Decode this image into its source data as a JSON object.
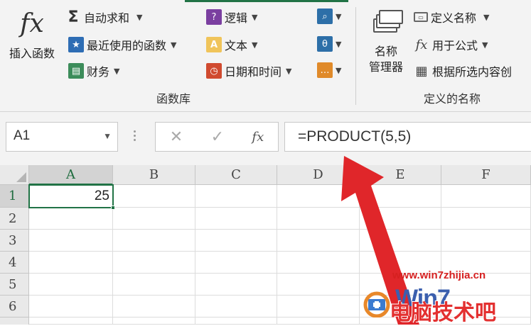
{
  "ribbon": {
    "insert_function": {
      "label": "插入函数",
      "icon": "fx-icon"
    },
    "functions": {
      "autosum": "自动求和",
      "recent": "最近使用的函数",
      "financial": "财务",
      "logical": "逻辑",
      "text": "文本",
      "datetime": "日期和时间",
      "text_icon_letter": "A"
    },
    "group_label_library": "函数库",
    "name_manager": {
      "line1": "名称",
      "line2": "管理器"
    },
    "define_name": "定义名称",
    "use_in_formula": "用于公式",
    "create_from_selection": "根据所选内容创",
    "group_label_names": "定义的名称"
  },
  "formula_bar": {
    "name_box": "A1",
    "cancel_icon": "✕",
    "enter_icon": "✓",
    "fx": "fx",
    "formula": "=PRODUCT(5,5)"
  },
  "sheet": {
    "columns": [
      "A",
      "B",
      "C",
      "D",
      "E",
      "F"
    ],
    "rows": [
      "1",
      "2",
      "3",
      "4",
      "5",
      "6"
    ],
    "cells": {
      "A1": "25"
    },
    "selected_cell": "A1"
  },
  "watermark": {
    "url": "www.win7zhijia.cn",
    "brand": "Win7",
    "cn": "电脑技术吧"
  },
  "colors": {
    "accent": "#217346",
    "arrow": "#e0262a"
  }
}
